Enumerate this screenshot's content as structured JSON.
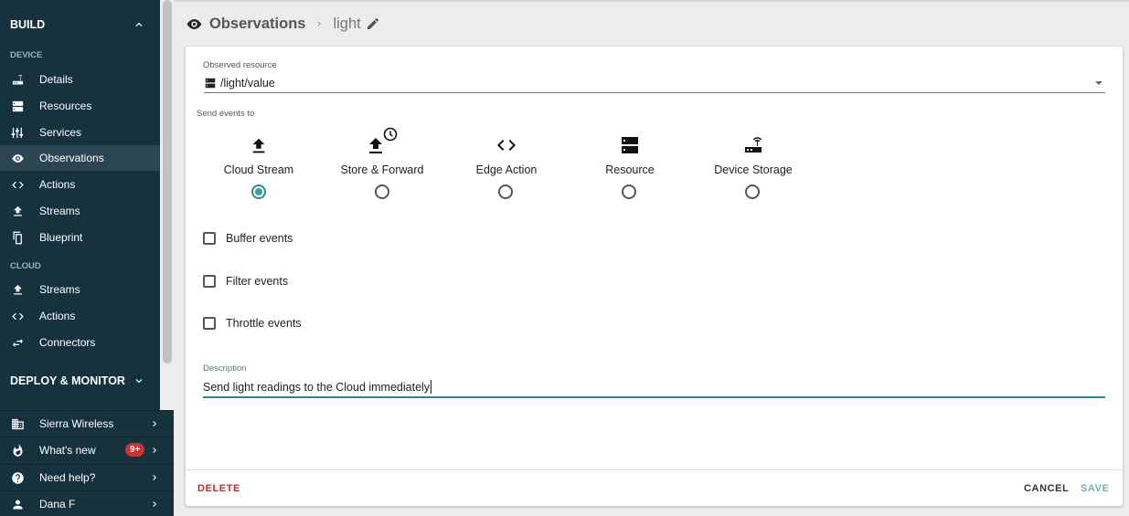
{
  "sidebar": {
    "build_label": "BUILD",
    "device_group": "DEVICE",
    "device_items": [
      {
        "label": "Details",
        "icon": "router-icon"
      },
      {
        "label": "Resources",
        "icon": "server-icon"
      },
      {
        "label": "Services",
        "icon": "tune-icon"
      },
      {
        "label": "Observations",
        "icon": "eye-icon"
      },
      {
        "label": "Actions",
        "icon": "code-icon"
      },
      {
        "label": "Streams",
        "icon": "upload-icon"
      },
      {
        "label": "Blueprint",
        "icon": "copy-icon"
      }
    ],
    "cloud_group": "CLOUD",
    "cloud_items": [
      {
        "label": "Streams",
        "icon": "upload-icon"
      },
      {
        "label": "Actions",
        "icon": "code-icon"
      },
      {
        "label": "Connectors",
        "icon": "swap-icon"
      }
    ],
    "deploy_label": "DEPLOY & MONITOR",
    "bottom_items": [
      {
        "label": "Sierra Wireless",
        "icon": "building-icon"
      },
      {
        "label": "What's new",
        "icon": "fire-icon",
        "badge": "9+"
      },
      {
        "label": "Need help?",
        "icon": "help-icon"
      },
      {
        "label": "Dana F",
        "icon": "person-icon"
      }
    ]
  },
  "header": {
    "section": "Observations",
    "item": "light"
  },
  "form": {
    "resource_label": "Observed resource",
    "resource_value": "/light/value",
    "send_label": "Send events to",
    "destinations": [
      {
        "label": "Cloud Stream",
        "icon": "upload-icon",
        "selected": true
      },
      {
        "label": "Store & Forward",
        "icon": "upload-clock-icon",
        "selected": false
      },
      {
        "label": "Edge Action",
        "icon": "code-icon",
        "selected": false
      },
      {
        "label": "Resource",
        "icon": "server-icon",
        "selected": false
      },
      {
        "label": "Device Storage",
        "icon": "router-icon",
        "selected": false
      }
    ],
    "checkboxes": [
      {
        "label": "Buffer events",
        "checked": false
      },
      {
        "label": "Filter events",
        "checked": false
      },
      {
        "label": "Throttle events",
        "checked": false
      }
    ],
    "description_label": "Description",
    "description_value": "Send light readings to the Cloud immediately"
  },
  "footer": {
    "delete_label": "DELETE",
    "cancel_label": "CANCEL",
    "save_label": "SAVE"
  },
  "colors": {
    "sidebar_bg": "#16323e",
    "accent": "#2d8a8a",
    "danger": "#c62828",
    "badge": "#d32f2f"
  }
}
